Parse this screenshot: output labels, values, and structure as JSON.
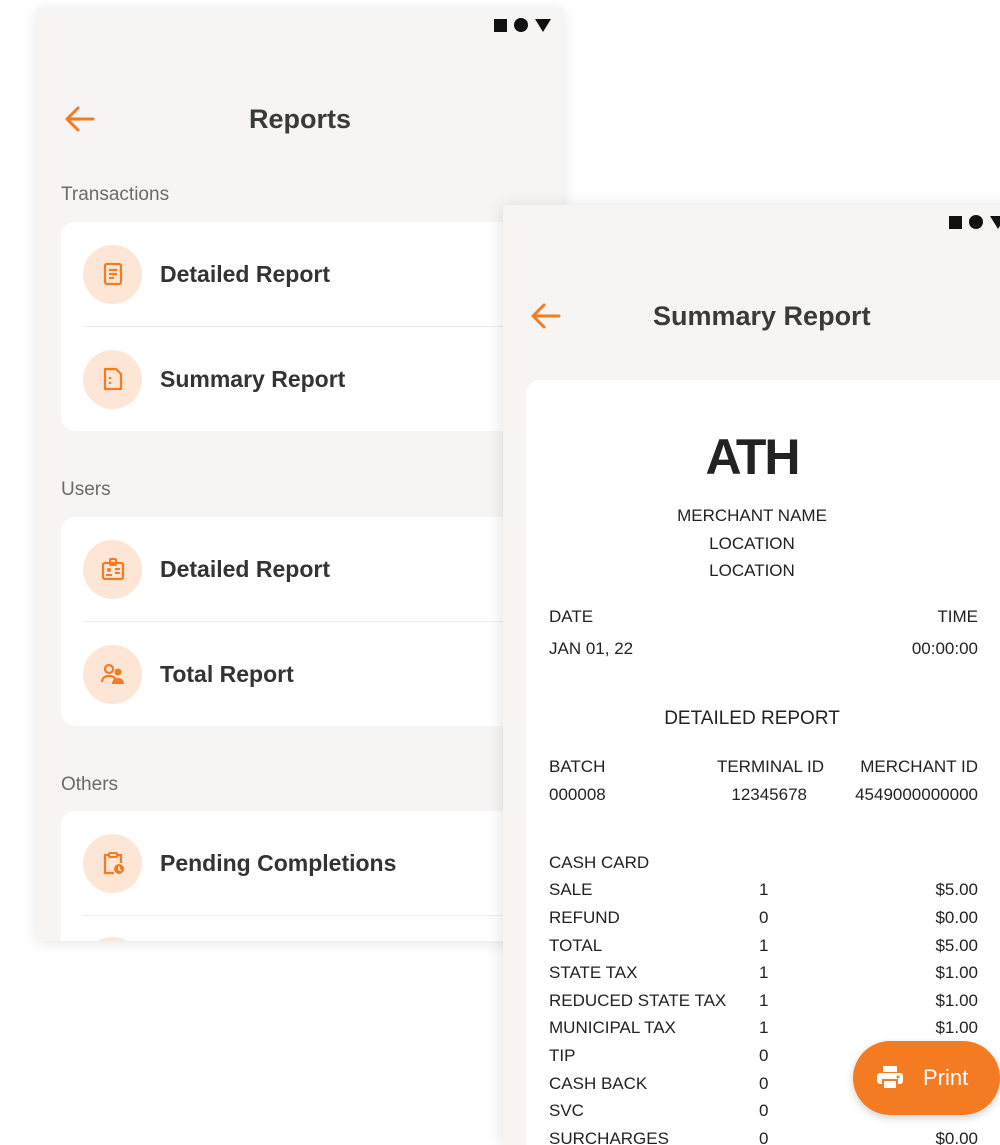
{
  "colors": {
    "accent": "#f47b22",
    "icon_bg": "#fde6d6",
    "background": "#f6f5f4",
    "card": "#ffffff"
  },
  "reports_screen": {
    "title": "Reports",
    "sections": [
      {
        "label": "Transactions",
        "items": [
          {
            "label": "Detailed Report",
            "icon": "receipt-icon"
          },
          {
            "label": "Summary Report",
            "icon": "document-icon"
          }
        ]
      },
      {
        "label": "Users",
        "items": [
          {
            "label": "Detailed Report",
            "icon": "id-badge-icon"
          },
          {
            "label": "Total Report",
            "icon": "users-icon"
          }
        ]
      },
      {
        "label": "Others",
        "items": [
          {
            "label": "Pending Completions",
            "icon": "clipboard-clock-icon"
          }
        ]
      }
    ]
  },
  "summary_screen": {
    "title": "Summary Report",
    "logo": "ATH",
    "merchant_name": "MERCHANT NAME",
    "location_1": "LOCATION",
    "location_2": "LOCATION",
    "date_label": "DATE",
    "time_label": "TIME",
    "date_value": "JAN 01, 22",
    "time_value": "00:00:00",
    "report_title": "DETAILED REPORT",
    "batch_label": "BATCH",
    "terminal_label": "TERMINAL ID",
    "merchant_id_label": "MERCHANT ID",
    "batch_value": "000008",
    "terminal_value": "12345678",
    "merchant_id_value": "4549000000000",
    "card_type": "CASH CARD",
    "lines": [
      {
        "label": "SALE",
        "count": "1",
        "amount": "$5.00"
      },
      {
        "label": "REFUND",
        "count": "0",
        "amount": "$0.00"
      },
      {
        "label": "TOTAL",
        "count": "1",
        "amount": "$5.00"
      },
      {
        "label": "STATE TAX",
        "count": "1",
        "amount": "$1.00"
      },
      {
        "label": "REDUCED STATE TAX",
        "count": "1",
        "amount": "$1.00"
      },
      {
        "label": "MUNICIPAL TAX",
        "count": "1",
        "amount": "$1.00"
      },
      {
        "label": "TIP",
        "count": "0",
        "amount": ""
      },
      {
        "label": "CASH BACK",
        "count": "0",
        "amount": ""
      },
      {
        "label": "SVC",
        "count": "0",
        "amount": ""
      },
      {
        "label": "SURCHARGES",
        "count": "0",
        "amount": "$0.00"
      }
    ],
    "print_label": "Print"
  }
}
